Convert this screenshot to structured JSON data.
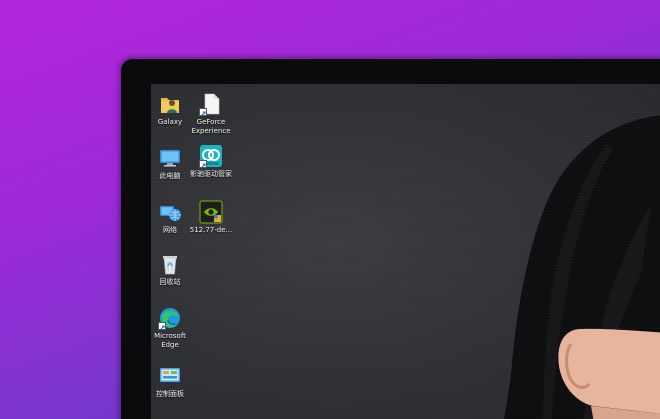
{
  "desktop": {
    "icons": [
      {
        "label": "Galaxy"
      },
      {
        "label": "GeForce Experience"
      },
      {
        "label": "此电脑"
      },
      {
        "label": "影驰驱动管家"
      },
      {
        "label": "网络"
      },
      {
        "label": "512.77-de..."
      },
      {
        "label": "回收站"
      },
      {
        "label": "Microsoft Edge"
      },
      {
        "label": "控制面板"
      }
    ]
  },
  "colors": {
    "wallpaper_gradient_start": "#b327dc",
    "wallpaper_gradient_end": "#5a3ec7",
    "bezel": "#0b0b0d",
    "screen": "#2f3033",
    "nvidia_green": "#76b900"
  }
}
